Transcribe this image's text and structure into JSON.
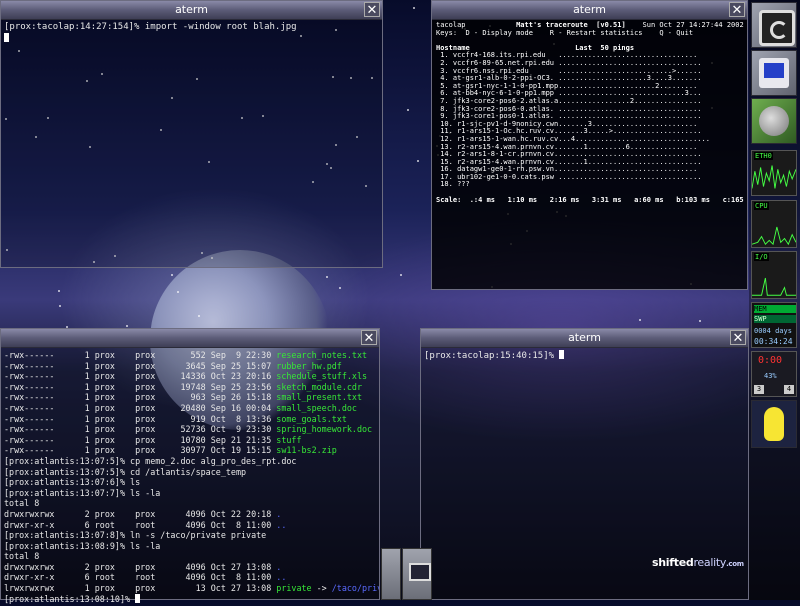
{
  "windows": {
    "top_left": {
      "title": "aterm",
      "lines": [
        "[prox:tacolap:14:27:154]% import -window root blah.jpg"
      ]
    },
    "mtr": {
      "title": "aterm",
      "header_host": "tacolap",
      "header_title": "Matt's traceroute  [v0.51]",
      "header_date": "Sun Oct 27 14:27:44 2002",
      "keys": "Keys:  D - Display mode    R - Restart statistics    Q - Quit",
      "col_host": "Hostname",
      "col_last": "Last  50 pings",
      "hops": [
        "1. vccfr4-168.its.rpi.edu",
        "2. vccfr6-89-65.net.rpi.edu",
        "3. vccfr6.nss.rpi.edu",
        "4. at-gsr1-alb-0-2-ppi-OC3.",
        "5. at-gsr1-nyc-1-1-0-pp1.mpp",
        "6. at-bb4-nyc-6-1-0-pp1.mpp",
        "7. jfk3-core2-pos6-2.atlas.a",
        "8. jfk3-core2-pos6-0.atlas.",
        "9. jfk3-core1-pos0-1.atlas.",
        "10. r1-sjc-pv1-d-9nonicy.cwn",
        "11. r1-ars15-1-Oc.hc.ruv.cv.",
        "12. r1-ars15-1-wan.hc.ruv.cv.",
        "13. r2-ars15-4.wan.prnvn.cv.",
        "14. r2-ars1-8-1-cr.prnvn.cv.",
        "15. r2-ars15-4.wan.prnvn.cv.",
        "16. datagw1-ge0-1-rh.psw.vn.",
        "17. ubr102-ge1-0-0.cats.psw",
        "18. ???"
      ],
      "pings": [
        ".................................",
        "..................................",
        "...........................>......",
        ".....................3....3.......",
        ".......................2.........",
        "..............................3...",
        ".................2................",
        "..................................",
        "..................................",
        ".......3.........................",
        "......3.....>.....................",
        "..4................................",
        "......1.........6................",
        "..................................",
        "......1...........................",
        ".................................",
        "..................................",
        ""
      ],
      "scale": "Scale:  .:4 ms   1:10 ms   2:16 ms   3:31 ms   a:60 ms   b:103 ms   c:165 ms"
    },
    "bottom_left": {
      "listing": [
        {
          "perm": "-rwx------",
          "links": "1",
          "owner": "prox",
          "group": "prox",
          "size": "552",
          "date": "Sep  9 22:30",
          "name": "research_notes.txt"
        },
        {
          "perm": "-rwx------",
          "links": "1",
          "owner": "prox",
          "group": "prox",
          "size": "3645",
          "date": "Sep 25 15:07",
          "name": "rubber_hw.pdf"
        },
        {
          "perm": "-rwx------",
          "links": "1",
          "owner": "prox",
          "group": "prox",
          "size": "14336",
          "date": "Oct 23 20:16",
          "name": "schedule_stuff.xls"
        },
        {
          "perm": "-rwx------",
          "links": "1",
          "owner": "prox",
          "group": "prox",
          "size": "19748",
          "date": "Sep 25 23:56",
          "name": "sketch_module.cdr"
        },
        {
          "perm": "-rwx------",
          "links": "1",
          "owner": "prox",
          "group": "prox",
          "size": "963",
          "date": "Sep 26 15:18",
          "name": "small_present.txt"
        },
        {
          "perm": "-rwx------",
          "links": "1",
          "owner": "prox",
          "group": "prox",
          "size": "20480",
          "date": "Sep 16 00:04",
          "name": "small_speech.doc"
        },
        {
          "perm": "-rwx------",
          "links": "1",
          "owner": "prox",
          "group": "prox",
          "size": "919",
          "date": "Oct  8 13:36",
          "name": "some_goals.txt"
        },
        {
          "perm": "-rwx------",
          "links": "1",
          "owner": "prox",
          "group": "prox",
          "size": "52736",
          "date": "Oct  9 23:30",
          "name": "spring_homework.doc"
        },
        {
          "perm": "-rwx------",
          "links": "1",
          "owner": "prox",
          "group": "prox",
          "size": "10780",
          "date": "Sep 21 21:35",
          "name": "stuff"
        },
        {
          "perm": "-rwx------",
          "links": "1",
          "owner": "prox",
          "group": "prox",
          "size": "30977",
          "date": "Oct 19 15:15",
          "name": "sw11-bs2.zip"
        }
      ],
      "cmd1": "[prox:atlantis:13:07:5]% cp memo_2.doc alg_pro_des_rpt.doc",
      "cmd2": "[prox:atlantis:13:07:5]% cd /atlantis/space_temp",
      "cmd3": "[prox:atlantis:13:07:6]% ls",
      "cmd4": "[prox:atlantis:13:07:7]% ls -la",
      "total1": "total 8",
      "dir1": [
        {
          "perm": "drwxrwxrwx",
          "links": "2",
          "owner": "prox",
          "group": "prox",
          "size": "4096",
          "date": "Oct 22 20:18",
          "name": "."
        },
        {
          "perm": "drwxr-xr-x",
          "links": "6",
          "owner": "root",
          "group": "root",
          "size": "4096",
          "date": "Oct  8 11:00",
          "name": ".."
        }
      ],
      "cmd5": "[prox:atlantis:13:07:8]% ln -s /taco/private private",
      "cmd6": "[prox:atlantis:13:08:9]% ls -la",
      "total2": "total 8",
      "dir2": [
        {
          "perm": "drwxrwxrwx",
          "links": "2",
          "owner": "prox",
          "group": "prox",
          "size": "4096",
          "date": "Oct 27 13:08",
          "name": "."
        },
        {
          "perm": "drwxr-xr-x",
          "links": "6",
          "owner": "root",
          "group": "root",
          "size": "4096",
          "date": "Oct  8 11:00",
          "name": ".."
        }
      ],
      "link_row": {
        "perm": "lrwxrwxrwx",
        "links": "1",
        "owner": "prox",
        "group": "prox",
        "size": "13",
        "date": "Oct 27 13:08",
        "name": "private",
        "arrow": "->",
        "target": "/taco/private"
      },
      "prompt": "[prox:atlantis:13:08:10]%"
    },
    "bottom_right": {
      "title": "aterm",
      "prompt": "[prox:tacolap:15:40:15]%"
    }
  },
  "dock": {
    "mon_labels": [
      "ETH0",
      "CPU",
      "I/O",
      "MEM",
      "SWP"
    ],
    "uptime": "0004 days",
    "clock": "00:34:24",
    "battery_time": "0:00",
    "battery_pct": "43%",
    "desk_a": "3",
    "desk_b": "4"
  },
  "watermark": {
    "a": "shifted",
    "b": "reality",
    "c": ".com"
  },
  "colors": {
    "term_green": "#37e837",
    "term_blue": "#5a6bff"
  }
}
